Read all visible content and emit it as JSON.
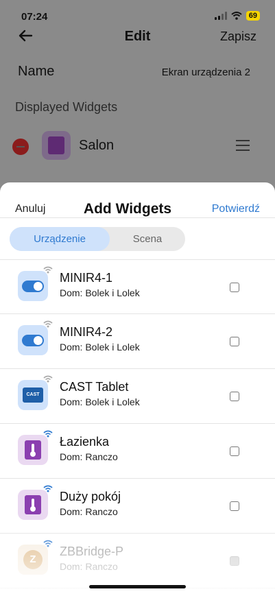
{
  "status": {
    "time": "07:24",
    "battery": "69"
  },
  "nav": {
    "title": "Edit",
    "save_label": "Zapisz"
  },
  "name_row": {
    "label": "Name",
    "value": "Ekran urządzenia 2"
  },
  "displayed": {
    "header": "Displayed Widgets",
    "items": [
      {
        "label": "Salon"
      }
    ]
  },
  "sheet": {
    "cancel_label": "Anuluj",
    "title": "Add Widgets",
    "confirm_label": "Potwierdź",
    "tabs": [
      {
        "label": "Urządzenie",
        "active": true
      },
      {
        "label": "Scena",
        "active": false
      }
    ],
    "devices": [
      {
        "name": "MINIR4-1",
        "home": "Dom: Bolek i Lolek",
        "icon": "toggle-switch-icon",
        "checked": false
      },
      {
        "name": "MINIR4-2",
        "home": "Dom: Bolek i Lolek",
        "icon": "toggle-switch-icon",
        "checked": false
      },
      {
        "name": "CAST Tablet",
        "home": "Dom: Bolek i Lolek",
        "icon": "cast-tablet-icon",
        "icon_text": "CAST",
        "checked": false
      },
      {
        "name": "Łazienka",
        "home": "Dom: Ranczo",
        "icon": "thermometer-icon",
        "checked": false
      },
      {
        "name": "Duży pokój",
        "home": "Dom: Ranczo",
        "icon": "thermometer-icon",
        "checked": false
      },
      {
        "name": "ZBBridge-P",
        "home": "Dom: Ranczo",
        "icon": "zigbee-bridge-icon",
        "icon_text": "Z",
        "checked": false
      }
    ]
  },
  "colors": {
    "accent": "#2f7ad0",
    "remove": "#8b1c1c",
    "thermo": "#8b3fb0"
  }
}
